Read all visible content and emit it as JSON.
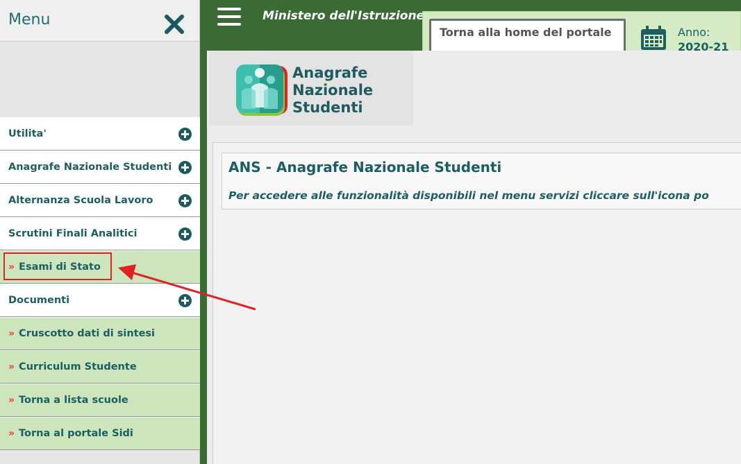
{
  "sidebar": {
    "title": "Menu",
    "close_icon": "close-icon",
    "items": [
      {
        "label": "Utilita'",
        "type": "expand"
      },
      {
        "label": "Anagrafe Nazionale Studenti",
        "type": "expand"
      },
      {
        "label": "Alternanza Scuola Lavoro",
        "type": "expand"
      },
      {
        "label": "Scrutini Finali Analitici",
        "type": "expand"
      },
      {
        "label": "Esami di Stato",
        "type": "link",
        "highlighted": true
      },
      {
        "label": "Documenti",
        "type": "expand"
      },
      {
        "label": "Cruscotto dati di sintesi",
        "type": "link"
      },
      {
        "label": "Curriculum Studente",
        "type": "link"
      },
      {
        "label": "Torna a lista scuole",
        "type": "link"
      },
      {
        "label": "Torna al portale Sidi",
        "type": "link"
      }
    ],
    "link_marker": "»"
  },
  "header": {
    "ministry": "Ministero dell'Istruzione",
    "home_button": "Torna alla home del portale",
    "anno_label": "Anno:",
    "anno_value": "2020-21"
  },
  "logo": {
    "line1": "Anagrafe",
    "line2": "Nazionale",
    "line3": "Studenti"
  },
  "main": {
    "title": "ANS - Anagrafe Nazionale Studenti",
    "subtitle": "Per accedere alle funzionalità disponibili nel menu servizi cliccare sull'icona po"
  },
  "colors": {
    "dark_green": "#3a6b35",
    "pale_green": "#cde5bc",
    "teal": "#1d5e63",
    "accent_red": "#e12222"
  }
}
